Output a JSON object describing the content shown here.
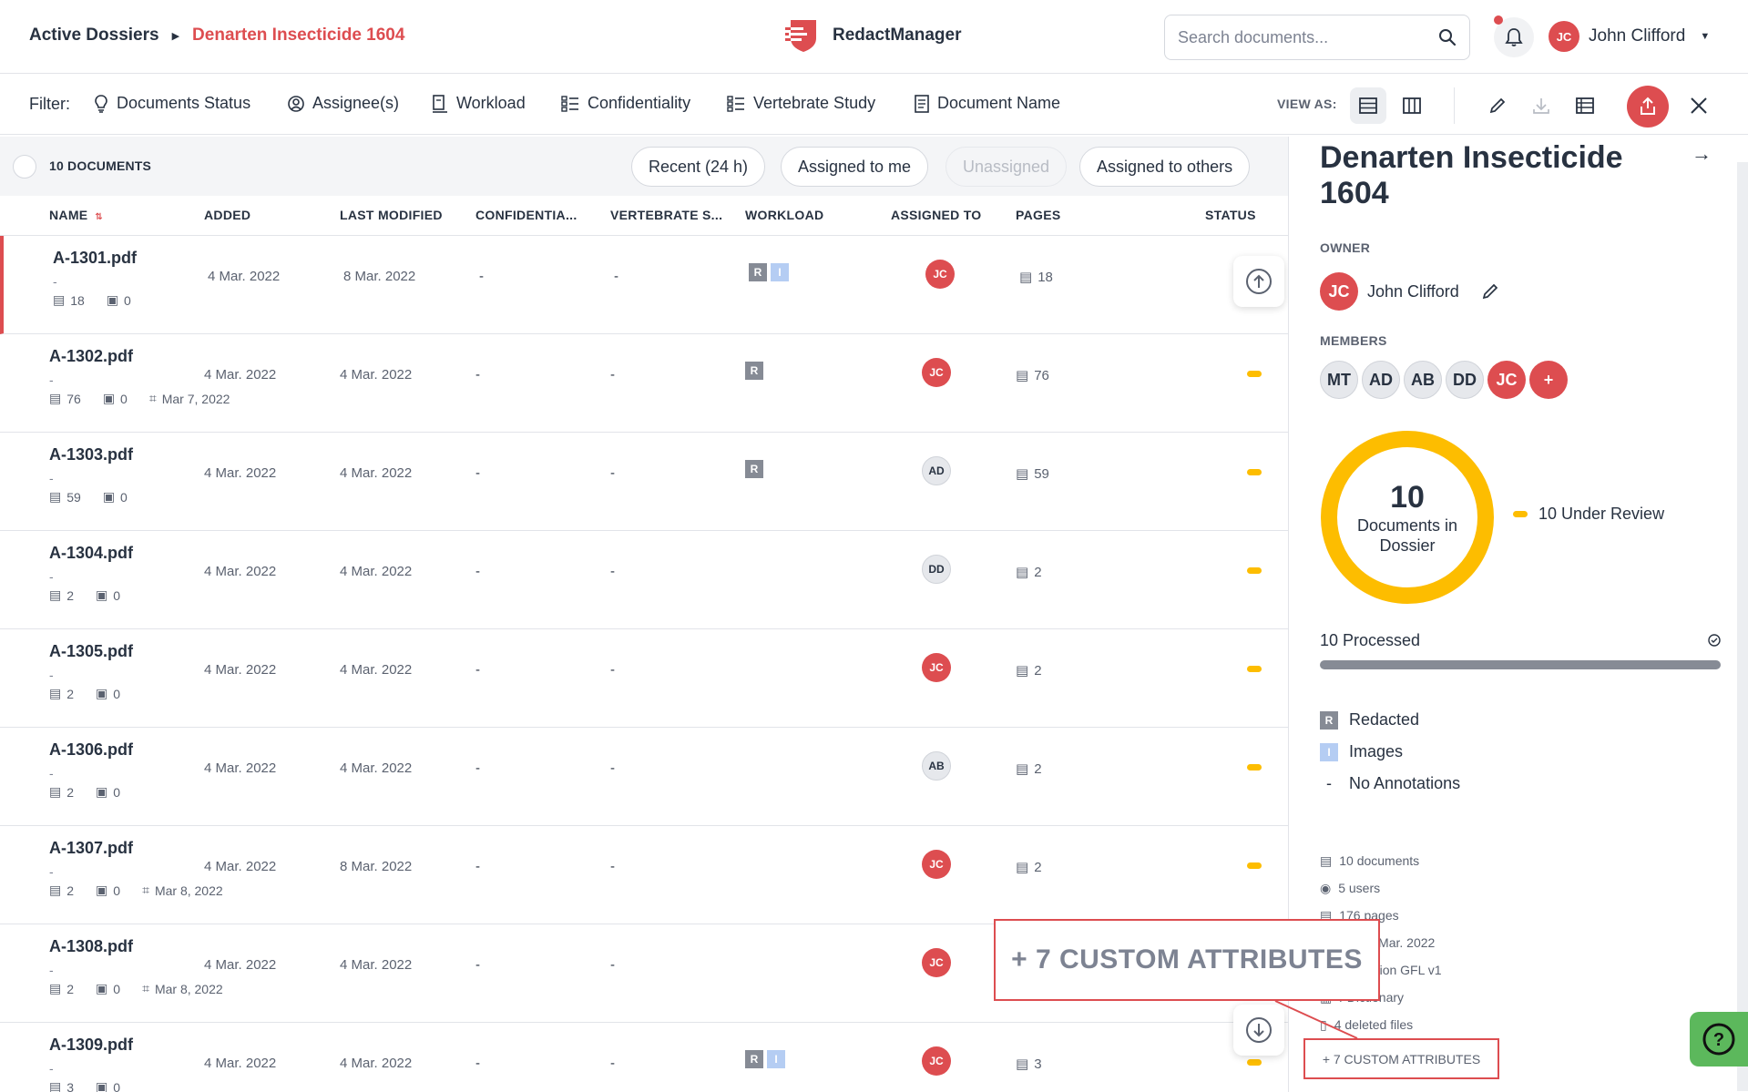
{
  "header": {
    "breadcrumb_root": "Active Dossiers",
    "breadcrumb_current": "Denarten Insecticide 1604",
    "app_name": "RedactManager",
    "search_placeholder": "Search documents...",
    "user_initials": "JC",
    "user_name": "John Clifford"
  },
  "filters": {
    "label": "Filter:",
    "items": [
      "Documents Status",
      "Assignee(s)",
      "Workload",
      "Confidentiality",
      "Vertebrate Study",
      "Document Name"
    ],
    "view_as_label": "VIEW AS:"
  },
  "list": {
    "count_label": "10 DOCUMENTS",
    "quick_filters": [
      "Recent (24 h)",
      "Assigned to me",
      "Unassigned",
      "Assigned to others"
    ],
    "columns": [
      "NAME",
      "ADDED",
      "LAST MODIFIED",
      "CONFIDENTIA...",
      "VERTEBRATE S...",
      "WORKLOAD",
      "ASSIGNED TO",
      "PAGES",
      "STATUS"
    ],
    "rows": [
      {
        "name": "A-1301.pdf",
        "sub": "-",
        "pages_meta": "18",
        "annot_meta": "0",
        "ocr": "",
        "added": "4 Mar. 2022",
        "modified": "8 Mar. 2022",
        "conf": "-",
        "vert": "-",
        "workload": [
          "R",
          "I"
        ],
        "assignee": "JC",
        "assignee_style": "red",
        "pages": "18",
        "status": "none"
      },
      {
        "name": "A-1302.pdf",
        "sub": "-",
        "pages_meta": "76",
        "annot_meta": "0",
        "ocr": "Mar 7, 2022",
        "added": "4 Mar. 2022",
        "modified": "4 Mar. 2022",
        "conf": "-",
        "vert": "-",
        "workload": [
          "R"
        ],
        "assignee": "JC",
        "assignee_style": "red",
        "pages": "76",
        "status": "review"
      },
      {
        "name": "A-1303.pdf",
        "sub": "-",
        "pages_meta": "59",
        "annot_meta": "0",
        "ocr": "",
        "added": "4 Mar. 2022",
        "modified": "4 Mar. 2022",
        "conf": "-",
        "vert": "-",
        "workload": [
          "R"
        ],
        "assignee": "AD",
        "assignee_style": "gray",
        "pages": "59",
        "status": "review"
      },
      {
        "name": "A-1304.pdf",
        "sub": "-",
        "pages_meta": "2",
        "annot_meta": "0",
        "ocr": "",
        "added": "4 Mar. 2022",
        "modified": "4 Mar. 2022",
        "conf": "-",
        "vert": "-",
        "workload": [],
        "assignee": "DD",
        "assignee_style": "gray",
        "pages": "2",
        "status": "review"
      },
      {
        "name": "A-1305.pdf",
        "sub": "-",
        "pages_meta": "2",
        "annot_meta": "0",
        "ocr": "",
        "added": "4 Mar. 2022",
        "modified": "4 Mar. 2022",
        "conf": "-",
        "vert": "-",
        "workload": [],
        "assignee": "JC",
        "assignee_style": "red",
        "pages": "2",
        "status": "review"
      },
      {
        "name": "A-1306.pdf",
        "sub": "-",
        "pages_meta": "2",
        "annot_meta": "0",
        "ocr": "",
        "added": "4 Mar. 2022",
        "modified": "4 Mar. 2022",
        "conf": "-",
        "vert": "-",
        "workload": [],
        "assignee": "AB",
        "assignee_style": "gray",
        "pages": "2",
        "status": "review"
      },
      {
        "name": "A-1307.pdf",
        "sub": "-",
        "pages_meta": "2",
        "annot_meta": "0",
        "ocr": "Mar 8, 2022",
        "added": "4 Mar. 2022",
        "modified": "8 Mar. 2022",
        "conf": "-",
        "vert": "-",
        "workload": [],
        "assignee": "JC",
        "assignee_style": "red",
        "pages": "2",
        "status": "review"
      },
      {
        "name": "A-1308.pdf",
        "sub": "-",
        "pages_meta": "2",
        "annot_meta": "0",
        "ocr": "Mar 8, 2022",
        "added": "4 Mar. 2022",
        "modified": "4 Mar. 2022",
        "conf": "-",
        "vert": "-",
        "workload": [],
        "assignee": "JC",
        "assignee_style": "red",
        "pages": "",
        "status": "none"
      },
      {
        "name": "A-1309.pdf",
        "sub": "-",
        "pages_meta": "3",
        "annot_meta": "0",
        "ocr": "",
        "added": "4 Mar. 2022",
        "modified": "4 Mar. 2022",
        "conf": "-",
        "vert": "-",
        "workload": [
          "R",
          "I"
        ],
        "assignee": "JC",
        "assignee_style": "red",
        "pages": "3",
        "status": "review"
      }
    ]
  },
  "panel": {
    "title": "Denarten Insecticide 1604",
    "owner_label": "OWNER",
    "owner_initials": "JC",
    "owner_name": "John Clifford",
    "members_label": "MEMBERS",
    "members": [
      "MT",
      "AD",
      "AB",
      "DD",
      "JC"
    ],
    "add_member": "+",
    "donut_value": "10",
    "donut_text_1": "Documents in",
    "donut_text_2": "Dossier",
    "legend_text": "10 Under Review",
    "processed_text": "10 Processed",
    "processed_fraction": 1.0,
    "workload_legend": [
      {
        "badge": "R",
        "label": "Redacted"
      },
      {
        "badge": "I",
        "label": "Images"
      },
      {
        "badge": "-",
        "label": "No Annotations"
      }
    ],
    "stats": [
      "10 documents",
      "5 users",
      "176 pages",
      "d on 4 Mar. 2022",
      "anitisation GFL v1",
      "r Dictionary",
      "4 deleted files"
    ],
    "custom_attributes": "+ 7 CUSTOM ATTRIBUTES"
  },
  "zoom_callout": "+ 7 CUSTOM ATTRIBUTES",
  "colors": {
    "accent": "#dd4d50",
    "review": "#fdbd00",
    "text": "#283241",
    "help": "#5cb85c"
  }
}
